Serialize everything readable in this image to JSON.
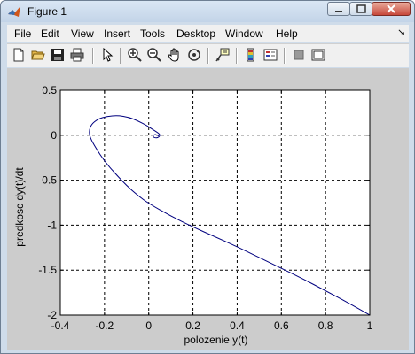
{
  "window": {
    "title": "Figure 1"
  },
  "menu": {
    "items": [
      "File",
      "Edit",
      "View",
      "Insert",
      "Tools",
      "Desktop",
      "Window",
      "Help"
    ],
    "dock_arrow": "↘"
  },
  "toolbar": {
    "icons": [
      "new-figure-icon",
      "open-file-icon",
      "save-icon",
      "print-icon",
      "edit-plot-icon",
      "zoom-in-icon",
      "zoom-out-icon",
      "pan-icon",
      "rotate-3d-icon",
      "data-cursor-icon",
      "colorbar-icon",
      "legend-icon",
      "hide-plot-tools-icon",
      "show-plot-tools-icon"
    ]
  },
  "colors": {
    "line": "#00007f",
    "figure_bg": "#cccccc",
    "axes_bg": "#ffffff"
  },
  "chart_data": {
    "type": "line",
    "title": "",
    "xlabel": "polozenie  y(t)",
    "ylabel": "predkosc  dy(t)/dt",
    "xlim": [
      -0.4,
      1
    ],
    "ylim": [
      -2,
      0.5
    ],
    "xticks": [
      "-0.4",
      "-0.2",
      "0",
      "0.2",
      "0.4",
      "0.6",
      "0.8",
      "1"
    ],
    "yticks": [
      "-2",
      "-1.5",
      "-1",
      "-0.5",
      "0",
      "0.5"
    ],
    "grid": true,
    "series": [
      {
        "x": [
          1.0,
          0.9,
          0.8,
          0.7,
          0.6,
          0.5,
          0.4,
          0.3,
          0.2,
          0.1,
          0.0,
          -0.05,
          -0.1,
          -0.15,
          -0.2,
          -0.24,
          -0.265,
          -0.27,
          -0.26,
          -0.23,
          -0.19,
          -0.14,
          -0.09,
          -0.05,
          -0.01,
          0.02,
          0.04,
          0.05,
          0.05,
          0.04,
          0.03,
          0.02,
          0.02,
          0.03,
          0.04,
          0.045
        ],
        "y": [
          -2.0,
          -1.86,
          -1.73,
          -1.6,
          -1.48,
          -1.36,
          -1.24,
          -1.13,
          -1.02,
          -0.9,
          -0.76,
          -0.67,
          -0.56,
          -0.43,
          -0.29,
          -0.14,
          -0.03,
          0.05,
          0.12,
          0.18,
          0.21,
          0.22,
          0.2,
          0.16,
          0.11,
          0.06,
          0.03,
          0.01,
          -0.01,
          -0.03,
          -0.03,
          -0.02,
          0.0,
          0.01,
          0.0,
          -0.01
        ]
      }
    ]
  }
}
